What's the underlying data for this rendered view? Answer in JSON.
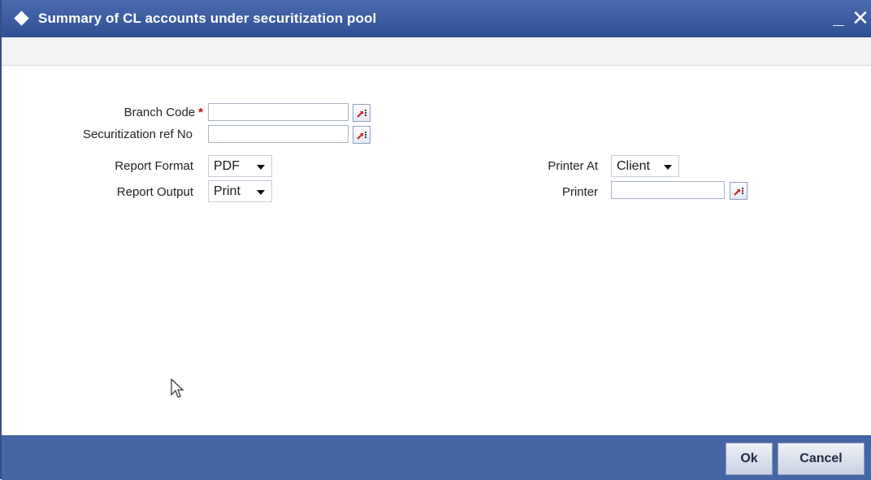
{
  "window": {
    "title": "Summary of CL accounts under securitization pool",
    "minimize_label": "_",
    "close_label": "✕"
  },
  "form": {
    "branch_code": {
      "label": "Branch Code",
      "required_mark": "*",
      "value": ""
    },
    "securitization_ref": {
      "label": "Securitization ref No",
      "value": ""
    },
    "report_format": {
      "label": "Report Format",
      "selected": "PDF"
    },
    "report_output": {
      "label": "Report Output",
      "selected": "Print"
    },
    "printer_at": {
      "label": "Printer At",
      "selected": "Client"
    },
    "printer": {
      "label": "Printer",
      "value": ""
    }
  },
  "footer": {
    "ok_label": "Ok",
    "cancel_label": "Cancel"
  },
  "colors": {
    "titlebar": "#2d4f92",
    "footer": "#4466a4",
    "required": "#cc0000",
    "lov_arrow": "#cc2222"
  },
  "icons": {
    "title": "diamond-icon",
    "lov": "lov-search-icon",
    "dropdown": "chevron-down-icon",
    "cursor": "mouse-pointer-icon"
  }
}
